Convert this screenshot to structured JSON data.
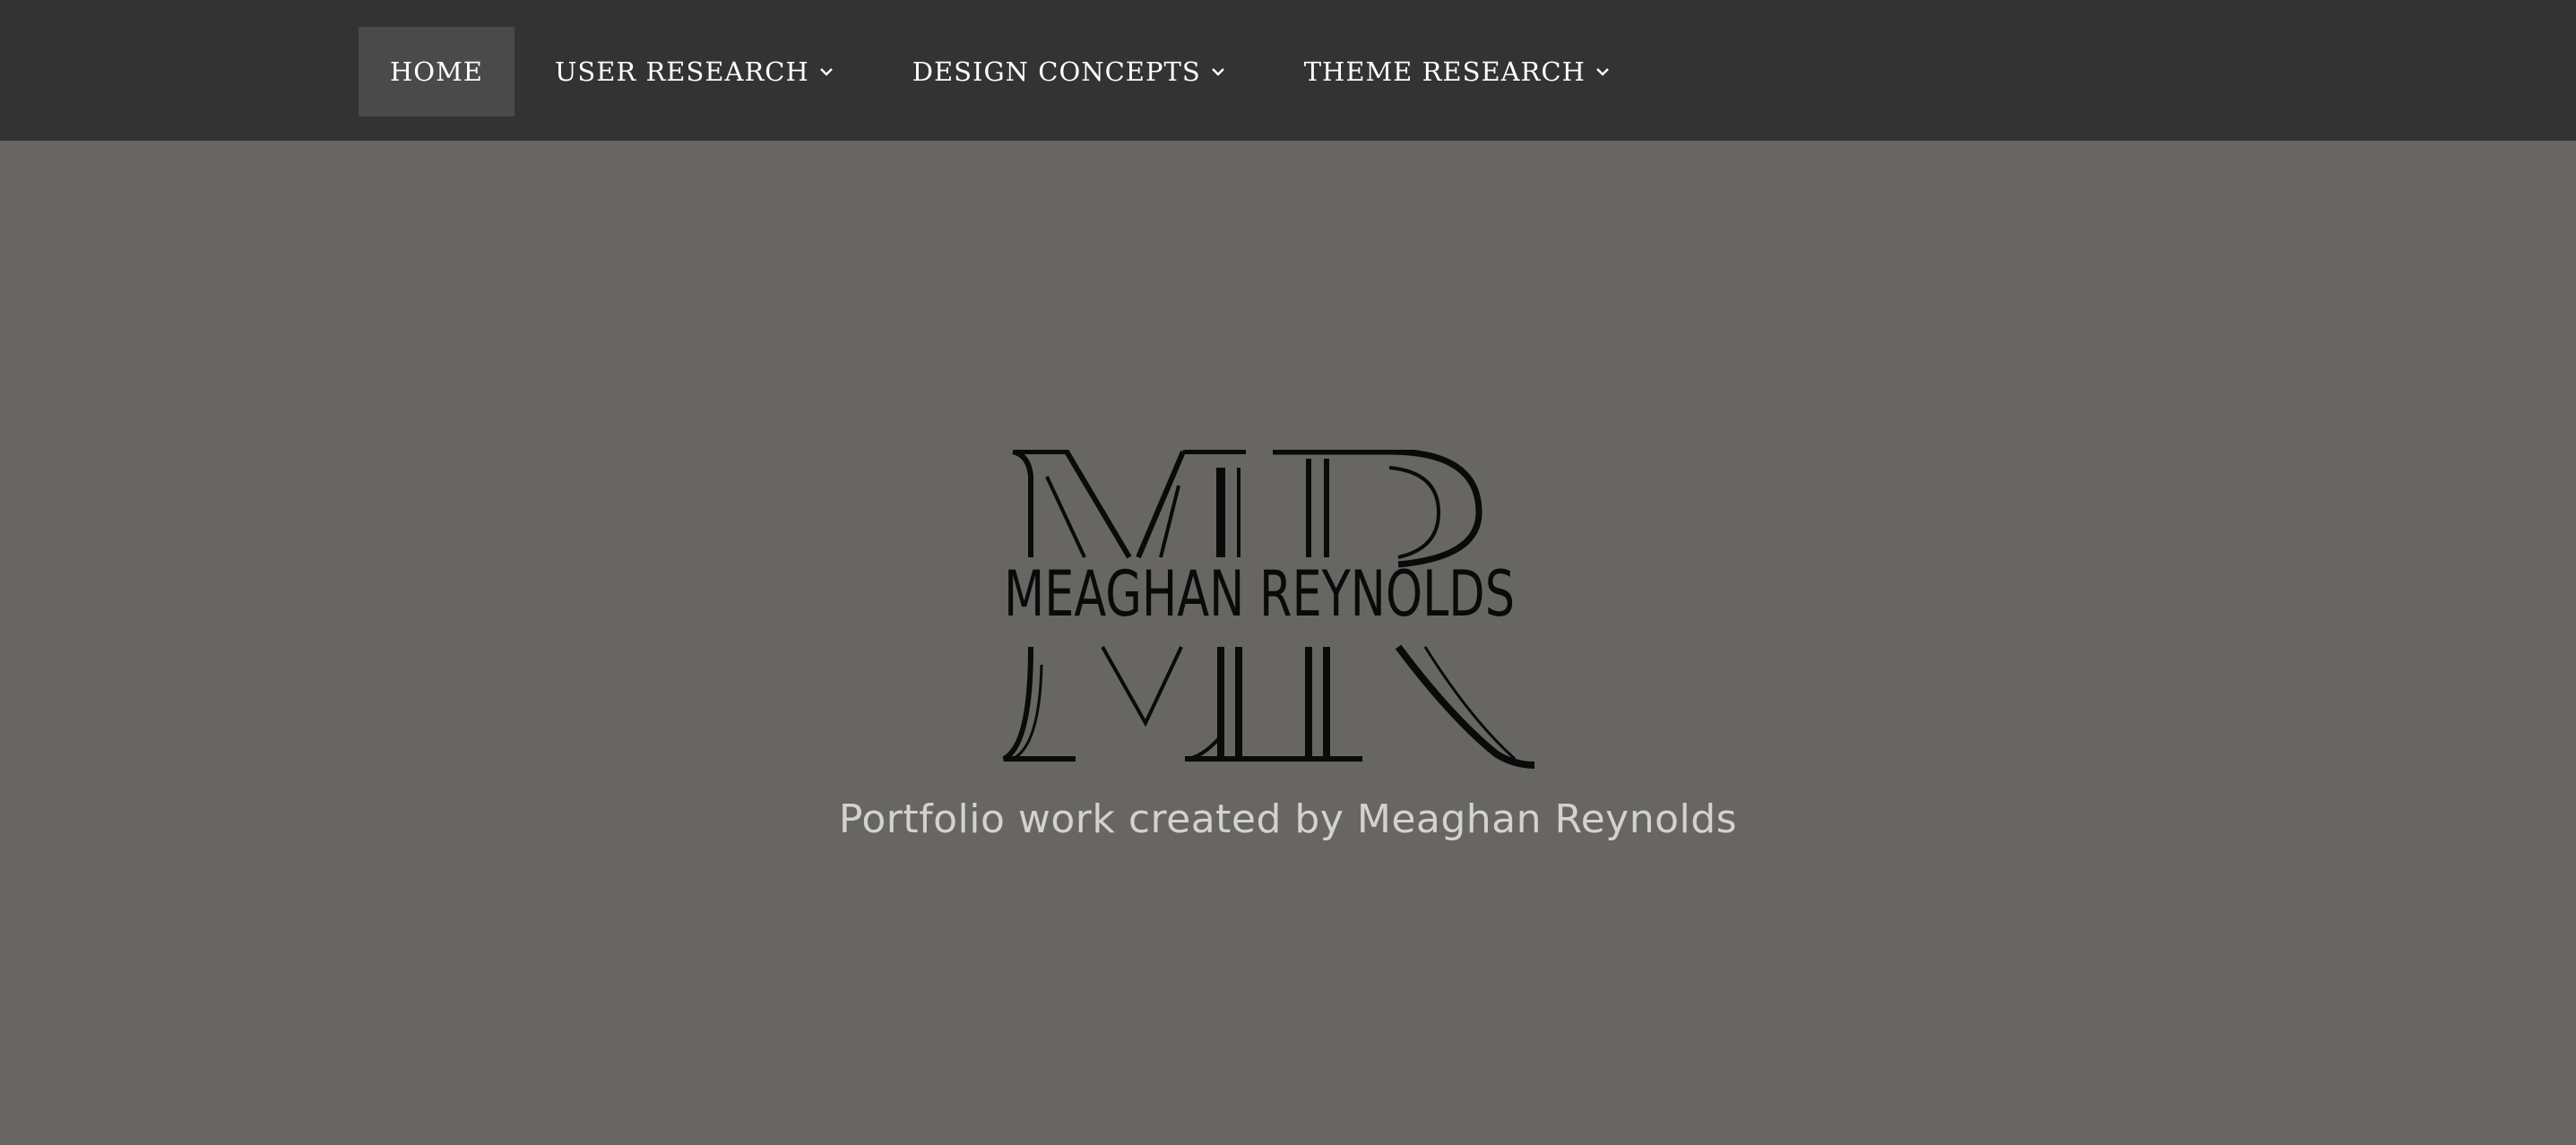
{
  "nav": {
    "items": [
      {
        "label": "HOME",
        "active": true,
        "has_dropdown": false
      },
      {
        "label": "USER RESEARCH",
        "active": false,
        "has_dropdown": true
      },
      {
        "label": "DESIGN CONCEPTS",
        "active": false,
        "has_dropdown": true
      },
      {
        "label": "THEME RESEARCH",
        "active": false,
        "has_dropdown": true
      }
    ]
  },
  "hero": {
    "logo_monogram": "MR",
    "logo_name": "MEAGHAN REYNOLDS",
    "tagline": "Portfolio work created by Meaghan Reynolds"
  },
  "colors": {
    "nav_bg": "#333333",
    "nav_active_bg": "#4a4a4a",
    "page_bg": "#676663",
    "tagline": "#d4d2cd",
    "logo": "#0a0a0a"
  }
}
